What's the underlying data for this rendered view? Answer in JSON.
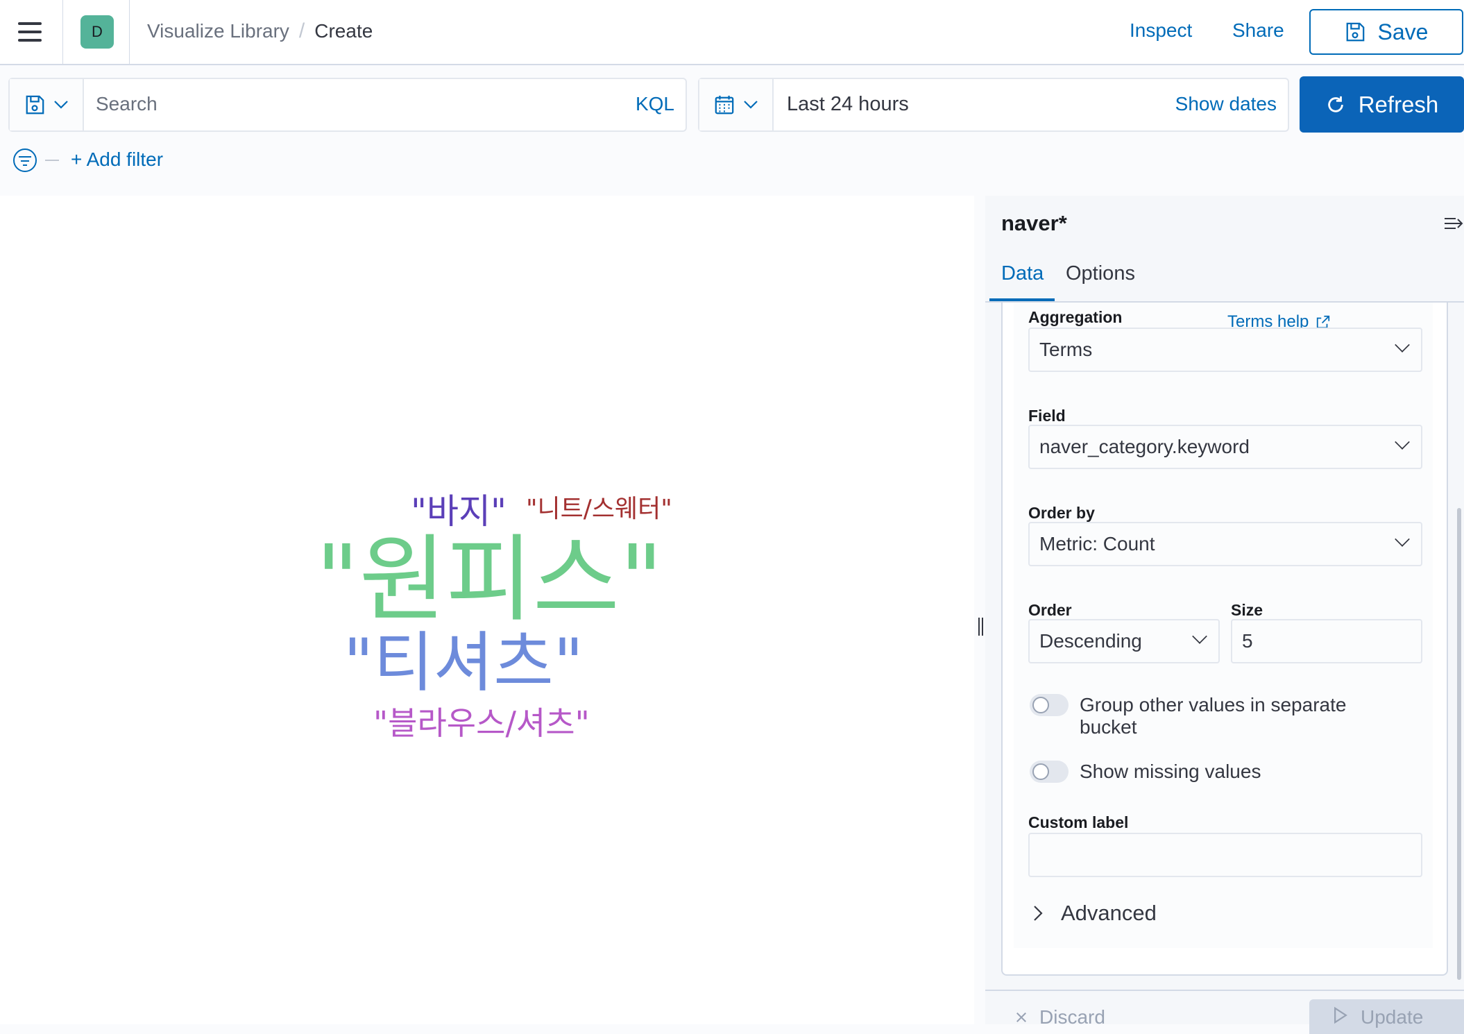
{
  "header": {
    "space_initial": "D",
    "breadcrumbs": [
      "Visualize Library",
      "Create"
    ],
    "inspect_label": "Inspect",
    "share_label": "Share",
    "save_label": "Save"
  },
  "query_bar": {
    "search_placeholder": "Search",
    "language_label": "KQL",
    "time_range": "Last 24 hours",
    "show_dates_label": "Show dates",
    "refresh_label": "Refresh",
    "add_filter_label": "+ Add filter"
  },
  "tag_cloud": {
    "words": [
      {
        "text": "\"원피스\"",
        "color": "#6dcc8a"
      },
      {
        "text": "\"티셔츠\"",
        "color": "#6d8bdb"
      },
      {
        "text": "\"바지\"",
        "color": "#5b3fb8"
      },
      {
        "text": "\"니트/스웨터\"",
        "color": "#a33030"
      },
      {
        "text": "\"블라우스/셔츠\"",
        "color": "#b658c8"
      }
    ]
  },
  "sidebar": {
    "index_pattern": "naver*",
    "tabs": [
      {
        "label": "Data"
      },
      {
        "label": "Options"
      }
    ],
    "aggregation": {
      "label": "Aggregation",
      "help_label": "Terms help",
      "value": "Terms"
    },
    "field": {
      "label": "Field",
      "value": "naver_category.keyword"
    },
    "order_by": {
      "label": "Order by",
      "value": "Metric: Count"
    },
    "order": {
      "label": "Order",
      "value": "Descending"
    },
    "size": {
      "label": "Size",
      "value": "5"
    },
    "group_other": {
      "label_line1": "Group other values in separate",
      "label_line2": "bucket",
      "enabled": false
    },
    "show_missing": {
      "label": "Show missing values",
      "enabled": false
    },
    "custom_label": {
      "label": "Custom label",
      "value": ""
    },
    "advanced_label": "Advanced",
    "discard_label": "Discard",
    "update_label": "Update"
  }
}
